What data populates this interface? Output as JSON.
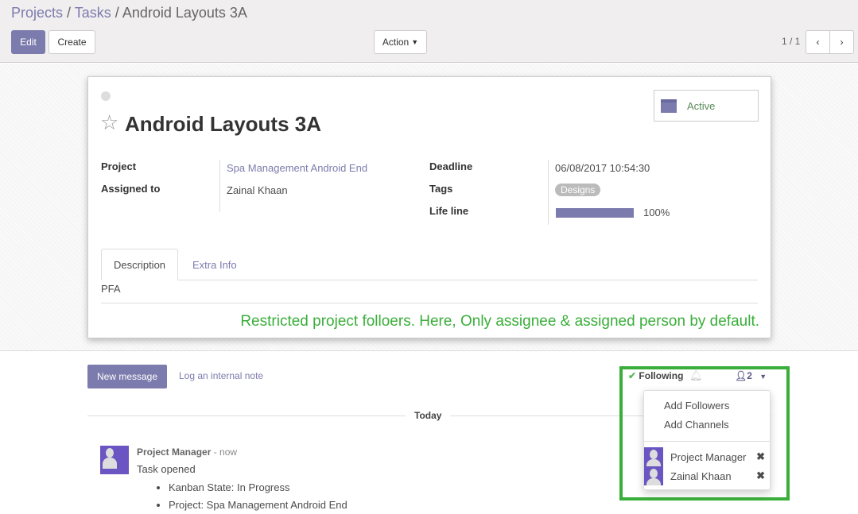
{
  "breadcrumb": {
    "projects": "Projects",
    "tasks": "Tasks",
    "current": "Android Layouts 3A",
    "sep": "/"
  },
  "toolbar": {
    "edit": "Edit",
    "create": "Create",
    "action": "Action",
    "pager": "1 / 1"
  },
  "task": {
    "title": "Android Layouts 3A",
    "status_button": "Active",
    "fields": {
      "project_label": "Project",
      "project": "Spa Management Android End",
      "assigned_label": "Assigned to",
      "assigned": "Zainal Khaan",
      "deadline_label": "Deadline",
      "deadline": "06/08/2017 10:54:30",
      "tags_label": "Tags",
      "tag": "Designs",
      "lifeline_label": "Life line",
      "lifeline": "100%",
      "lifeline_value": 100
    },
    "tabs": [
      "Description",
      "Extra Info"
    ],
    "description": "PFA",
    "annotation": "Restricted project folloers. Here, Only assignee & assigned person by default."
  },
  "chatter": {
    "new_message": "New message",
    "log_note": "Log an internal note",
    "following": "Following",
    "followers_count": "2",
    "today": "Today",
    "message": {
      "author": "Project Manager",
      "time": "- now",
      "body": "Task opened",
      "items": [
        "Kanban State: In Progress",
        "Project: Spa Management Android End"
      ]
    }
  },
  "followers_menu": {
    "add_followers": "Add Followers",
    "add_channels": "Add Channels",
    "followers": [
      "Project Manager",
      "Zainal Khaan"
    ]
  },
  "colors": {
    "brand": "#7c7bad",
    "annotation": "#3aae3a"
  }
}
